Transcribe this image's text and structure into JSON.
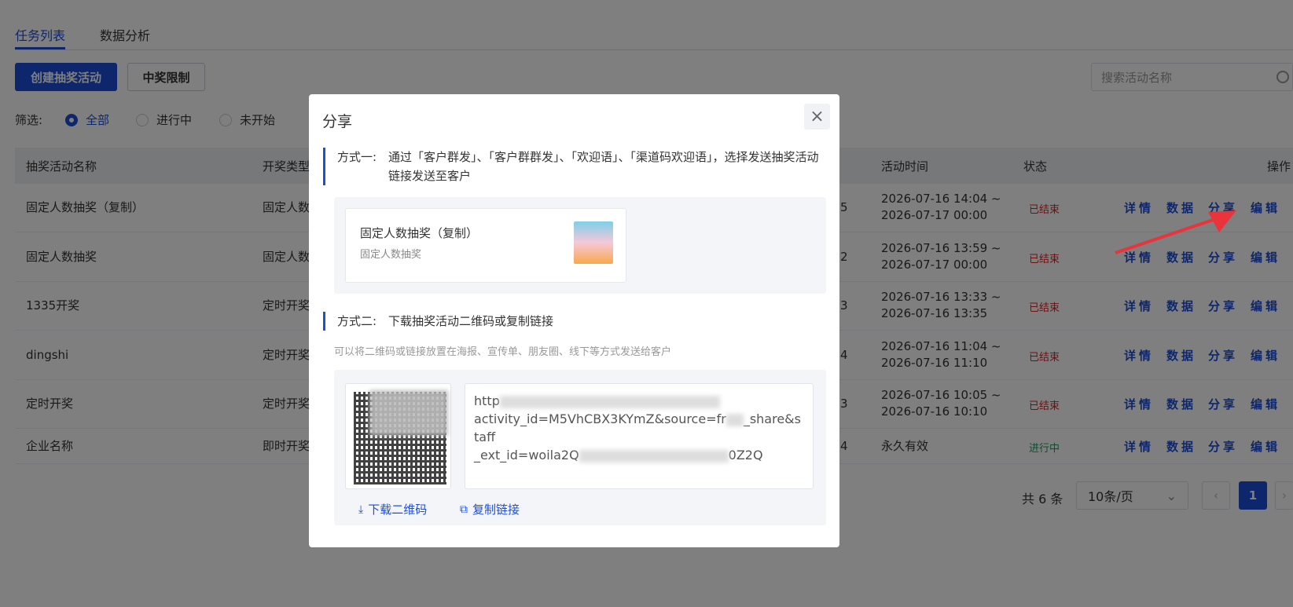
{
  "tabs": [
    "任务列表",
    "数据分析"
  ],
  "toolbar": {
    "create_label": "创建抽奖活动",
    "limit_label": "中奖限制",
    "search_placeholder": "搜索活动名称"
  },
  "filter": {
    "label": "筛选:",
    "options": [
      "全部",
      "进行中",
      "未开始"
    ],
    "selected": "全部"
  },
  "table": {
    "headers": [
      "抽奖活动名称",
      "开奖类型",
      "活动时间",
      "状态",
      "操作"
    ],
    "rows": [
      {
        "name": "固定人数抽奖（复制）",
        "type": "固定人数",
        "count": "5",
        "time1": "2026-07-16 14:04 ~",
        "time2": "2026-07-17 00:00",
        "status": "已结束"
      },
      {
        "name": "固定人数抽奖",
        "type": "固定人数",
        "count": "2",
        "time1": "2026-07-16 13:59 ~",
        "time2": "2026-07-17 00:00",
        "status": "已结束"
      },
      {
        "name": "1335开奖",
        "type": "定时开奖",
        "count": "3",
        "time1": "2026-07-16 13:33 ~",
        "time2": "2026-07-16 13:35",
        "status": "已结束"
      },
      {
        "name": "dingshi",
        "type": "定时开奖",
        "count": "4",
        "time1": "2026-07-16 11:04 ~",
        "time2": "2026-07-16 11:10",
        "status": "已结束"
      },
      {
        "name": "定时开奖",
        "type": "定时开奖",
        "count": "3",
        "time1": "2026-07-16 10:05 ~",
        "time2": "2026-07-16 10:10",
        "status": "已结束"
      },
      {
        "name": "企业名称",
        "type": "即时开奖",
        "count": "4",
        "time1": "永久有效",
        "time2": "",
        "status": "进行中"
      }
    ],
    "ops": [
      "详情",
      "数据",
      "分享",
      "编辑"
    ]
  },
  "pager": {
    "total": "共 6 条",
    "size": "10条/页",
    "current": "1"
  },
  "modal": {
    "title": "分享",
    "method1_label": "方式一:",
    "method1_text": "通过「客户群发」、「客户群群发」、「欢迎语」、「渠道码欢迎语」，选择发送抽奖活动链接发送至客户",
    "card_title": "固定人数抽奖（复制）",
    "card_sub": "固定人数抽奖",
    "method2_label": "方式二:",
    "method2_text": "下载抽奖活动二维码或复制链接",
    "hint": "可以将二维码或链接放置在海报、宣传单、朋友圈、线下等方式发送给客户",
    "link_part1": "http",
    "link_part2": "activity_id=M5VhCBX3KYmZ&source=fr",
    "link_part3": "_share&staff",
    "link_part4": "_ext_id=woila2Q",
    "link_part5": "0Z2Q",
    "download_label": "下载二维码",
    "copy_label": "复制链接"
  },
  "colors": {
    "primary": "#1c4fd9",
    "ended": "#e02020",
    "active": "#19a15f",
    "arrow": "#e8343a"
  }
}
